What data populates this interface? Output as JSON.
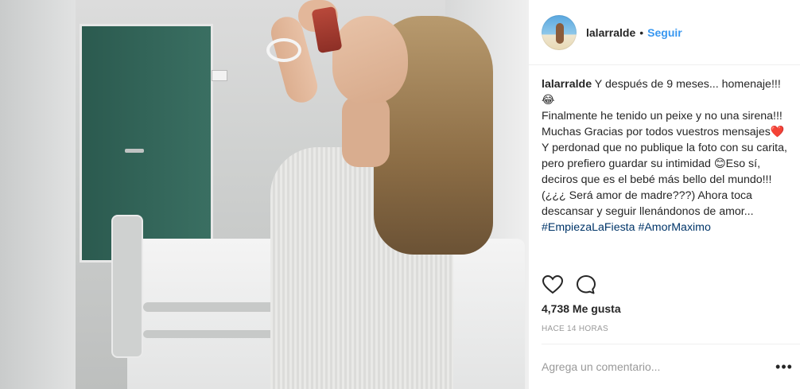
{
  "post": {
    "photo_alt": "post-photo",
    "header": {
      "username": "lalarralde",
      "separator": "•",
      "follow_label": "Seguir"
    },
    "caption": {
      "username": "lalarralde",
      "lines": [
        " Y después de 9 meses... homenaje!!!😂",
        "Finalmente he tenido un peixe y no una sirena!!! Muchas Gracias por todos vuestros mensajes❤️ Y perdonad que no publique la foto con su carita, pero prefiero guardar su intimidad 😊Eso sí, deciros que es el bebé más bello del mundo!!! (¿¿¿ Será amor de madre???) Ahora toca descansar y seguir llenándonos de amor..."
      ],
      "hashtags": "#EmpiezaLaFiesta #AmorMaximo"
    },
    "actions": {
      "like_icon": "heart-icon",
      "comment_icon": "comment-icon"
    },
    "likes": "4,738 Me gusta",
    "timestamp": "HACE 14 HORAS",
    "comment": {
      "placeholder": "Agrega un comentario...",
      "value": "",
      "more_label": "•••"
    }
  },
  "colors": {
    "accent": "#3897f0",
    "text": "#262626",
    "muted": "#999999",
    "divider": "#efefef",
    "hashtag": "#003569"
  }
}
